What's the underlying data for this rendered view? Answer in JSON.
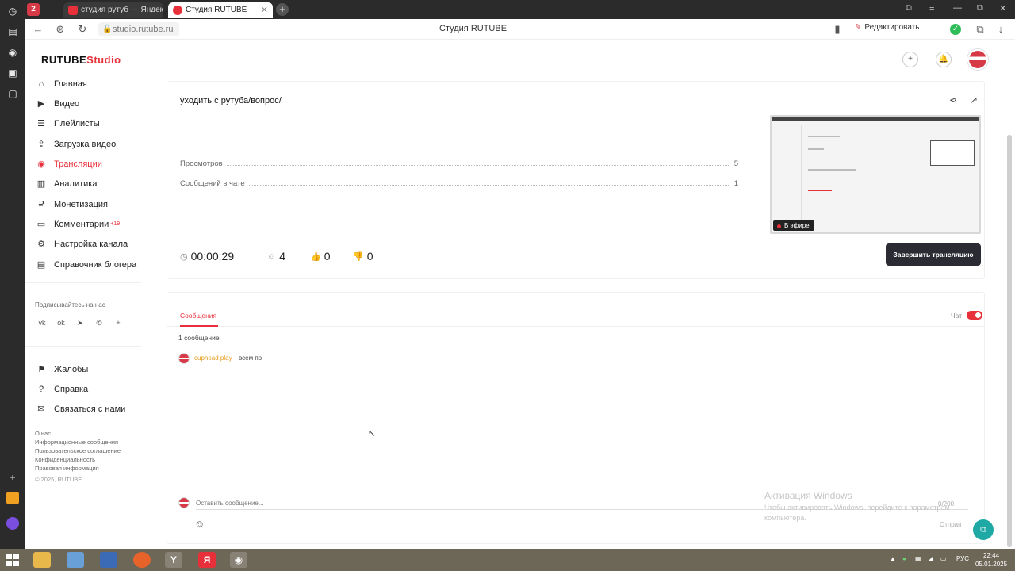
{
  "browser": {
    "tab_count": "2",
    "tabs": [
      {
        "title": "студия рутуб — Яндекс:",
        "icon": "yandex-icon"
      },
      {
        "title": "Студия RUTUBE",
        "icon": "rutube-icon"
      }
    ],
    "url": "studio.rutube.ru",
    "page_title": "Студия RUTUBE",
    "edit_label": "Редактировать"
  },
  "brand": {
    "name": "RUTUBE",
    "suffix": "Studio",
    "accent": "#e8303a"
  },
  "sidebar": {
    "items": [
      {
        "label": "Главная",
        "icon": "home-icon"
      },
      {
        "label": "Видео",
        "icon": "video-icon"
      },
      {
        "label": "Плейлисты",
        "icon": "playlist-icon"
      },
      {
        "label": "Загрузка видео",
        "icon": "upload-icon"
      },
      {
        "label": "Трансляции",
        "icon": "broadcast-icon",
        "active": true
      },
      {
        "label": "Аналитика",
        "icon": "analytics-icon"
      },
      {
        "label": "Монетизация",
        "icon": "monetization-icon"
      },
      {
        "label": "Комментарии",
        "icon": "comments-icon",
        "badge": "+19"
      },
      {
        "label": "Настройка канала",
        "icon": "gear-icon"
      },
      {
        "label": "Справочник блогера",
        "icon": "book-icon"
      }
    ],
    "follow_label": "Подписывайтесь на нас",
    "socials": [
      "vk-icon",
      "ok-icon",
      "telegram-icon",
      "viber-icon",
      "plus-icon"
    ],
    "secondary": [
      {
        "label": "Жалобы",
        "icon": "flag-icon"
      },
      {
        "label": "Справка",
        "icon": "help-icon"
      },
      {
        "label": "Связаться с нами",
        "icon": "mail-icon"
      }
    ],
    "footer_links": [
      "О нас",
      "Информационные сообщения",
      "Пользовательское соглашение",
      "Конфиденциальность",
      "Правовая информация"
    ],
    "copyright": "© 2025, RUTUBE"
  },
  "stream": {
    "title": "уходить с рутуба/вопрос/",
    "stats": [
      {
        "label": "Просмотров",
        "value": "5"
      },
      {
        "label": "Сообщений в чате",
        "value": "1"
      }
    ],
    "live_badge": "В эфире",
    "duration": "00:00:29",
    "viewers": "4",
    "likes": "0",
    "dislikes": "0",
    "end_button": "Завершить трансляцию"
  },
  "chat": {
    "tab_label": "Сообщения",
    "chat_toggle_label": "Чат",
    "chat_enabled": true,
    "count_label": "1 сообщение",
    "messages": [
      {
        "author": "cuphead play",
        "text": "всем пр"
      }
    ],
    "input_placeholder": "Оставить сообщение...",
    "char_count": "0/200",
    "send_label": "Отправ"
  },
  "watermark": {
    "title": "Активация Windows",
    "subtitle": "Чтобы активировать Windows, перейдите к параметрам компьютера."
  },
  "taskbar": {
    "language": "РУС",
    "time": "22:44",
    "date": "05.01.2025"
  }
}
